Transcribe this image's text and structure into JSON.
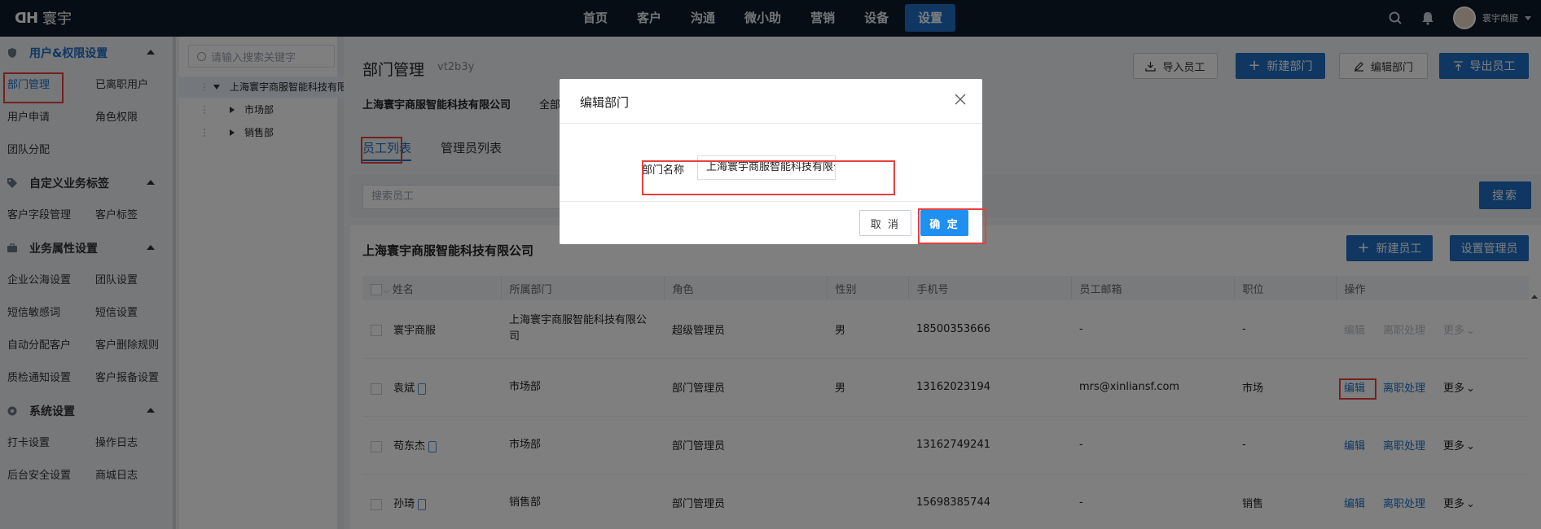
{
  "topbar": {
    "logo_mark": "ᗡᕼ",
    "brand": "寰宇",
    "nav": [
      "首页",
      "客户",
      "沟通",
      "微小助",
      "营销",
      "设备",
      "设置"
    ],
    "active_nav": "设置",
    "user_name": "寰宇商服"
  },
  "sidebar": {
    "sections": [
      {
        "title": "用户&权限设置",
        "icon": "shield-icon",
        "items": [
          "部门管理",
          "已离职用户",
          "用户申请",
          "角色权限",
          "团队分配"
        ]
      },
      {
        "title": "自定义业务标签",
        "icon": "tag-icon",
        "items": [
          "客户字段管理",
          "客户标签"
        ]
      },
      {
        "title": "业务属性设置",
        "icon": "briefcase-icon",
        "items": [
          "企业公海设置",
          "团队设置",
          "短信敏感词",
          "短信设置",
          "自动分配客户",
          "客户删除规则",
          "质检通知设置",
          "客户报备设置"
        ]
      },
      {
        "title": "系统设置",
        "icon": "gear-icon",
        "items": [
          "打卡设置",
          "操作日志",
          "后台安全设置",
          "商城日志"
        ]
      }
    ],
    "active_item": "部门管理"
  },
  "tree": {
    "search_placeholder": "请输入搜索关键字",
    "root": "上海寰宇商服智能科技有限公司",
    "children": [
      "市场部",
      "销售部"
    ]
  },
  "main": {
    "title": "部门管理",
    "subtitle": "vt2b3y",
    "buttons": {
      "import": "导入员工",
      "new_dept": "新建部门",
      "edit_dept": "编辑部门",
      "export": "导出员工"
    },
    "company": "上海寰宇商服智能科技有限公司",
    "scope": "全部",
    "tabs": [
      "员工列表",
      "管理员列表"
    ],
    "search_placeholder": "搜索员工",
    "search_button": "搜索",
    "card_title": "上海寰宇商服智能科技有限公司",
    "new_employee": "新建员工",
    "set_admin": "设置管理员",
    "columns": [
      "姓名",
      "所属部门",
      "角色",
      "性别",
      "手机号",
      "员工邮箱",
      "职位",
      "操作"
    ],
    "rows": [
      {
        "name": "寰宇商服",
        "phone_icon": false,
        "dept": "上海寰宇商服智能科技有限公司",
        "role": "超级管理员",
        "gender": "男",
        "mobile": "18500353666",
        "email": "-",
        "position": "-",
        "ops_disabled": true
      },
      {
        "name": "袁斌",
        "phone_icon": true,
        "dept": "市场部",
        "role": "部门管理员",
        "gender": "男",
        "mobile": "13162023194",
        "email": "mrs@xinliansf.com",
        "position": "市场",
        "ops_disabled": false
      },
      {
        "name": "苟东杰",
        "phone_icon": true,
        "dept": "市场部",
        "role": "部门管理员",
        "gender": "",
        "mobile": "13162749241",
        "email": "-",
        "position": "-",
        "ops_disabled": false
      },
      {
        "name": "孙琦",
        "phone_icon": true,
        "dept": "销售部",
        "role": "部门管理员",
        "gender": "",
        "mobile": "15698385744",
        "email": "-",
        "position": "销售",
        "ops_disabled": false
      }
    ],
    "ops": {
      "edit": "编辑",
      "resign": "离职处理",
      "more": "更多"
    }
  },
  "modal": {
    "title": "编辑部门",
    "field_label": "部门名称",
    "field_value": "上海寰宇商服智能科技有限公司",
    "cancel": "取 消",
    "ok": "确 定"
  }
}
